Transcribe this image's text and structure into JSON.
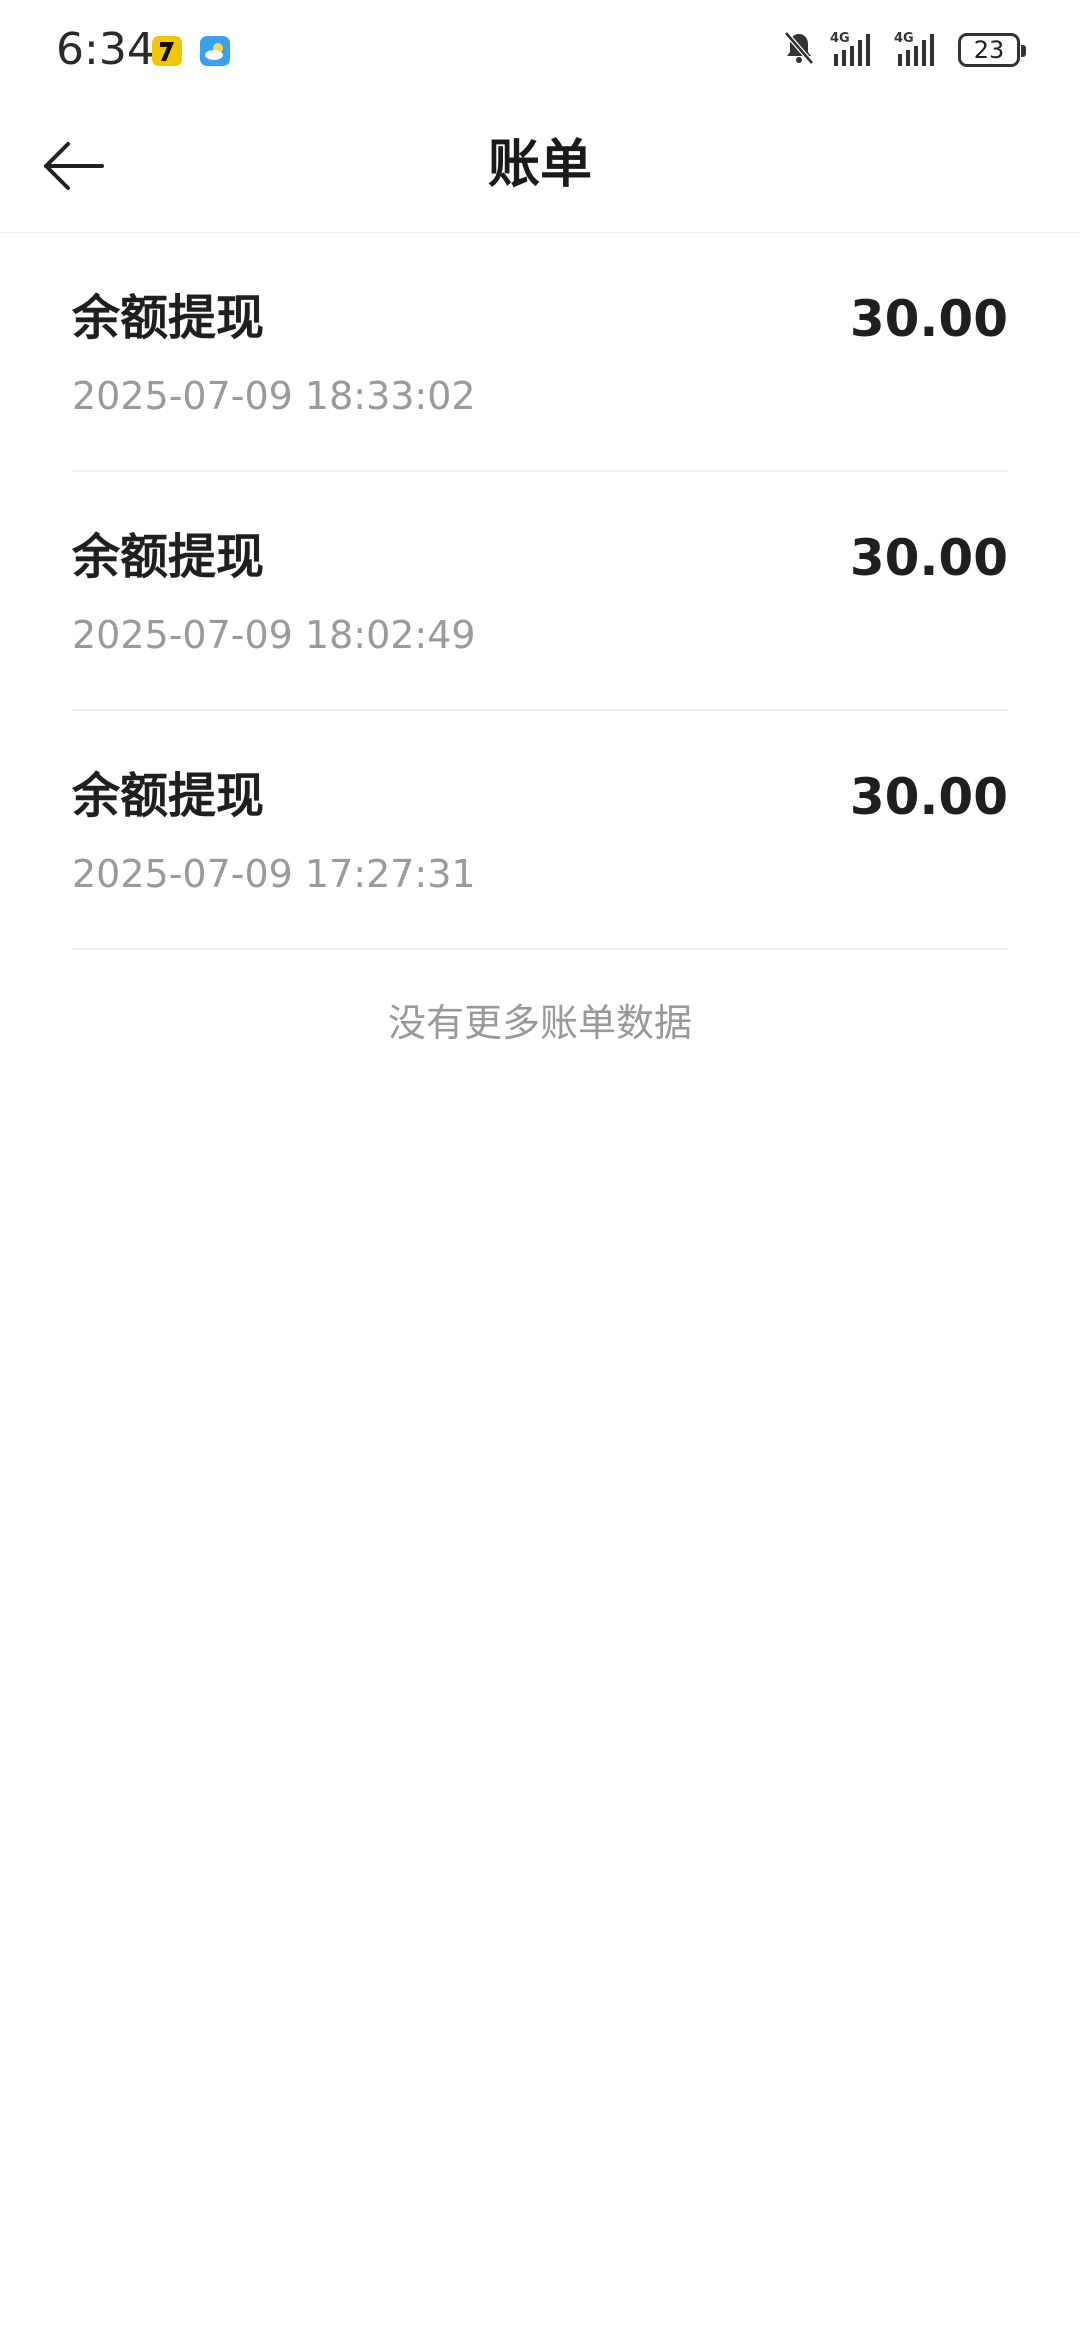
{
  "status_bar": {
    "time": "6:34",
    "battery": "23",
    "network": [
      "4G",
      "4G"
    ],
    "icons": [
      "app-7-icon",
      "weather-icon",
      "bell-muted-icon",
      "signal-icon",
      "signal-icon",
      "battery-icon"
    ]
  },
  "header": {
    "title": "账单",
    "back_icon": "arrow-left-icon"
  },
  "bills": [
    {
      "title": "余额提现",
      "amount": "30.00",
      "time": "2025-07-09 18:33:02"
    },
    {
      "title": "余额提现",
      "amount": "30.00",
      "time": "2025-07-09 18:02:49"
    },
    {
      "title": "余额提现",
      "amount": "30.00",
      "time": "2025-07-09 17:27:31"
    }
  ],
  "footer": {
    "no_more": "没有更多账单数据"
  }
}
